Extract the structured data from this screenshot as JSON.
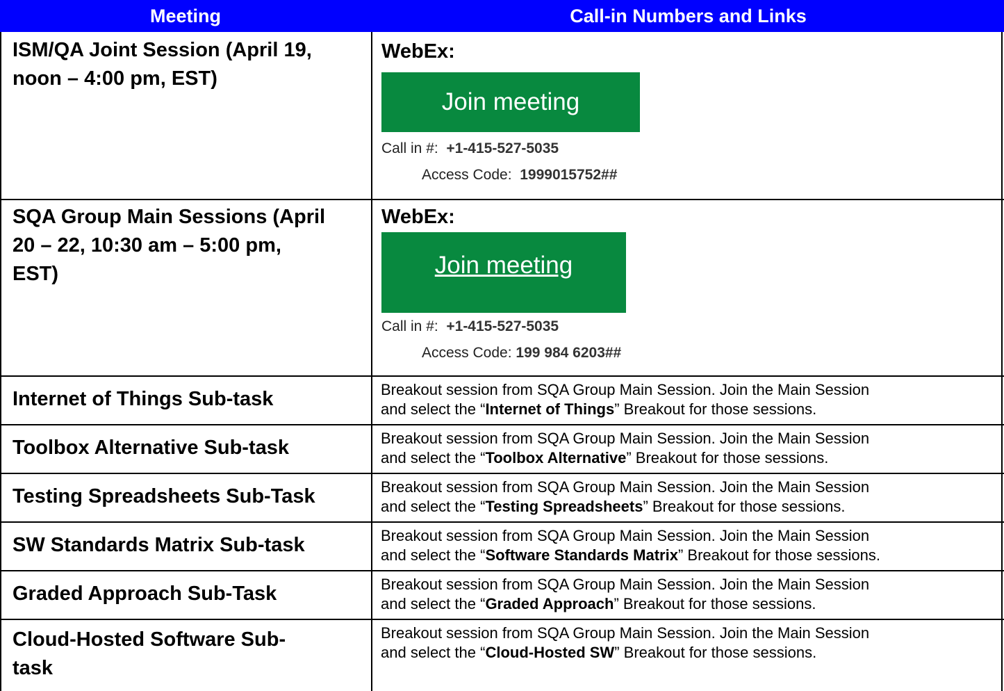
{
  "header": {
    "meeting": "Meeting",
    "links": "Call-in Numbers and Links"
  },
  "row1": {
    "meeting_line1": "ISM/QA Joint Session (April 19,",
    "meeting_line2": "noon – 4:00 pm, EST)",
    "webex_label": "WebEx:",
    "join_label": "Join meeting",
    "callin_label": "Call in #:",
    "callin_number": "+1-415-527-5035",
    "access_label": "Access Code:",
    "access_code": "1999015752##"
  },
  "row2": {
    "meeting_line1": "SQA Group Main Sessions (April",
    "meeting_line2": "20 – 22, 10:30 am – 5:00 pm,",
    "meeting_line3": "EST)",
    "webex_label": "WebEx:",
    "join_label": "Join meeting",
    "callin_label": "Call in #:",
    "callin_number": "+1-415-527-5035",
    "access_label": "Access Code:",
    "access_code": "199 984 6203##"
  },
  "breakouts": [
    {
      "meeting": "Internet of Things Sub-task",
      "line1": "Breakout session from SQA Group Main Session.  Join the Main Session",
      "line2_prefix": "and select the “",
      "name": "Internet of Things",
      "line2_suffix": "” Breakout for those sessions."
    },
    {
      "meeting": "Toolbox Alternative Sub-task",
      "line1": "Breakout session from SQA Group Main Session.  Join the Main Session",
      "line2_prefix": "and select the “",
      "name": "Toolbox Alternative",
      "line2_suffix": "” Breakout for those sessions."
    },
    {
      "meeting": "Testing Spreadsheets Sub-Task",
      "line1": "Breakout session from SQA Group Main Session.  Join the Main Session",
      "line2_prefix": "and select the “",
      "name": "Testing Spreadsheets",
      "line2_suffix": "” Breakout for those sessions."
    },
    {
      "meeting": "SW Standards Matrix Sub-task",
      "line1": "Breakout session from SQA Group Main Session.  Join the Main Session",
      "line2_prefix": "and select the “",
      "name": "Software Standards Matrix",
      "line2_suffix": "” Breakout for those sessions."
    },
    {
      "meeting": "Graded Approach Sub-Task",
      "line1": "Breakout session from SQA Group Main Session.  Join the Main Session",
      "line2_prefix": "and select the “",
      "name": "Graded Approach",
      "line2_suffix": "” Breakout for those sessions."
    },
    {
      "meeting": "Cloud-Hosted Software Sub-",
      "meeting_line2": "task",
      "line1": "Breakout session from SQA Group Main Session.  Join the Main Session",
      "line2_prefix": "and select the “",
      "name": "Cloud-Hosted SW",
      "line2_suffix": "” Breakout for those sessions."
    }
  ],
  "colors": {
    "header_bg": "#0000ff",
    "header_text": "#ffffff",
    "join_button_bg": "#08893f",
    "join_button_text": "#ffffff"
  }
}
